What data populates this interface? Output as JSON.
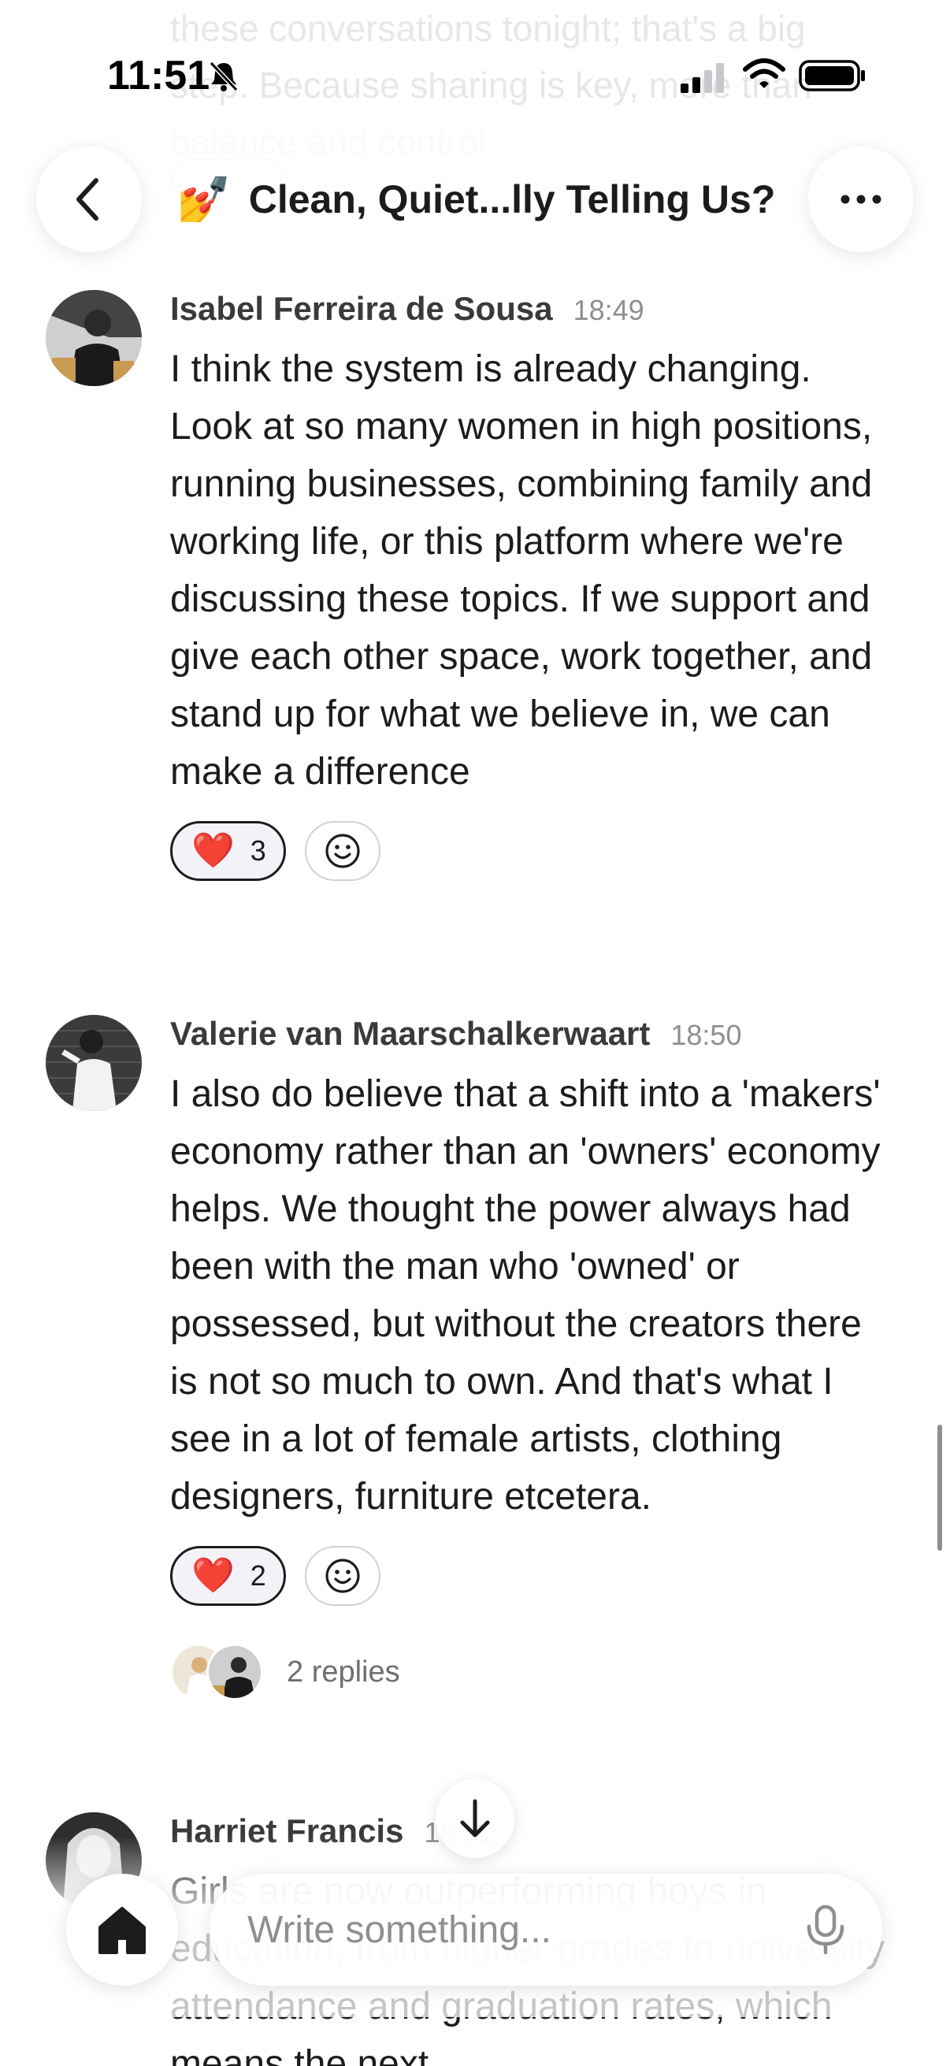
{
  "status_bar": {
    "time": "11:51"
  },
  "header": {
    "emoji": "💅",
    "title": "Clean, Quiet...lly Telling Us?"
  },
  "messages": [
    {
      "author": "Isabel Ferreira de Sousa",
      "time": "18:49",
      "text": "I think the system is already changing. Look at so many women in high positions, running businesses, combining family and working life, or this platform where we're discussing these topics. If we support and give each other space, work together, and stand up for what we believe in, we can make a difference",
      "reaction": {
        "emoji": "❤️",
        "count": "3"
      }
    },
    {
      "author": "Valerie van Maarschalkerwaart",
      "time": "18:50",
      "text": "I also do believe that a shift into a 'makers' economy rather than an 'owners' economy helps. We thought the power always had been with the man who 'owned' or possessed, but without the creators there is not so much to own. And that's what I see in a lot of female artists, clothing designers, furniture etcetera.",
      "reaction": {
        "emoji": "❤️",
        "count": "2"
      },
      "replies": "2 replies"
    },
    {
      "author": "Harriet Francis",
      "time": "18:51",
      "text": "Girls are now outperforming boys in education, from higher grades to university attendance and graduation rates, which means the next"
    }
  ],
  "ghost_top_text": "these conversations tonight; that's a big step. Because sharing is key, more than balance and control.",
  "compose": {
    "placeholder": "Write something..."
  },
  "colors": {
    "heart": "#e0262f",
    "text": "#1c1c1e",
    "muted": "#8e8e93"
  }
}
